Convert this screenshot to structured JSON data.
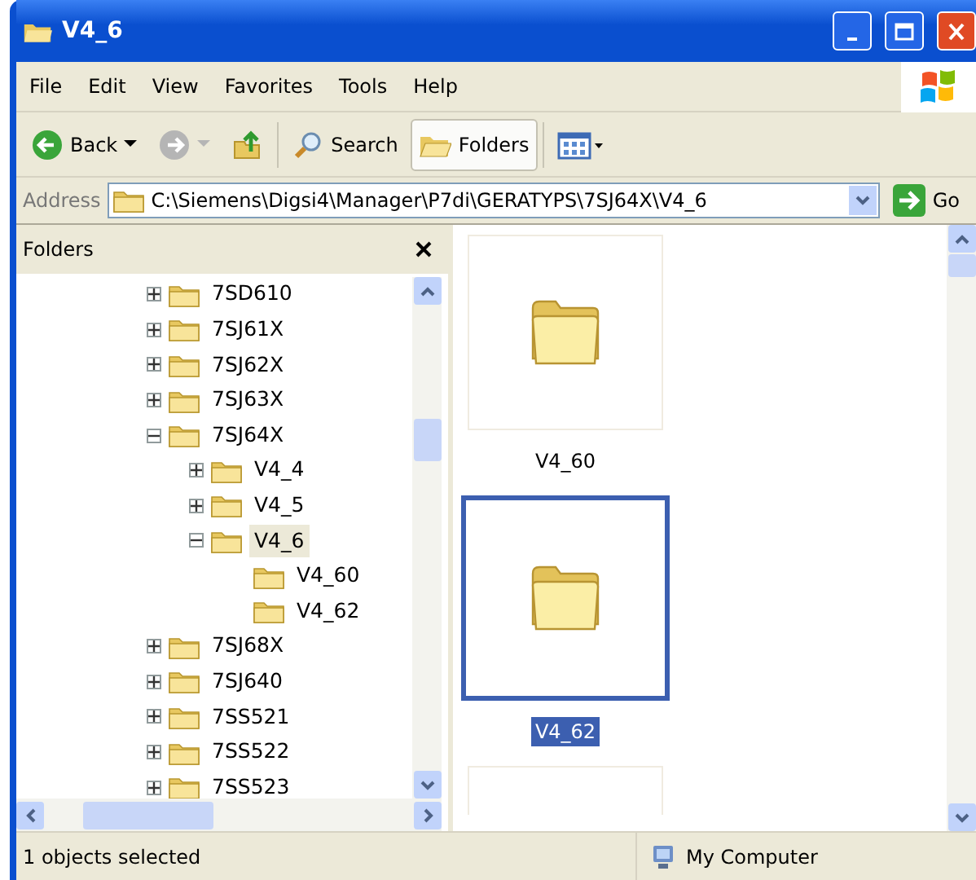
{
  "window": {
    "title": "V4_6"
  },
  "menu": [
    "File",
    "Edit",
    "View",
    "Favorites",
    "Tools",
    "Help"
  ],
  "toolbar": [
    {
      "kind": "back",
      "label": "Back",
      "disabled": false
    },
    {
      "kind": "forward",
      "disabled": true
    },
    {
      "kind": "up"
    },
    {
      "kind": "search",
      "label": "Search",
      "selected": false
    },
    {
      "kind": "folders",
      "label": "Folders",
      "selected": true
    },
    {
      "kind": "views"
    }
  ],
  "address": {
    "label": "Address",
    "value": "C:\\Siemens\\Digsi4\\Manager\\P7di\\GERATYPS\\7SJ64X\\V4_6",
    "go": "Go"
  },
  "folders_pane": {
    "title": "Folders",
    "tree": [
      {
        "label": "7SD610",
        "expanded": false,
        "selected": false
      },
      {
        "label": "7SJ61X",
        "expanded": false,
        "selected": false
      },
      {
        "label": "7SJ62X",
        "expanded": false,
        "selected": false
      },
      {
        "label": "7SJ63X",
        "expanded": false,
        "selected": false
      },
      {
        "label": "7SJ64X",
        "expanded": true,
        "selected": false,
        "children": [
          {
            "label": "V4_4",
            "expanded": false,
            "selected": false
          },
          {
            "label": "V4_5",
            "expanded": false,
            "selected": false
          },
          {
            "label": "V4_6",
            "expanded": true,
            "selected": true,
            "children": [
              {
                "label": "V4_60",
                "selected": false
              },
              {
                "label": "V4_62",
                "selected": false
              }
            ]
          }
        ]
      },
      {
        "label": "7SJ68X",
        "expanded": false,
        "selected": false
      },
      {
        "label": "7SJ640",
        "expanded": false,
        "selected": false
      },
      {
        "label": "7SS521",
        "expanded": false,
        "selected": false
      },
      {
        "label": "7SS522",
        "expanded": false,
        "selected": false
      },
      {
        "label": "7SS523",
        "expanded": false,
        "selected": false
      }
    ]
  },
  "files": [
    {
      "kind": "folder",
      "name": "V4_60",
      "selected": false
    },
    {
      "kind": "folder",
      "name": "V4_62",
      "selected": true
    },
    {
      "kind": "cut_off"
    }
  ],
  "status_bar": {
    "text": "1 objects selected",
    "zone": "My Computer"
  }
}
